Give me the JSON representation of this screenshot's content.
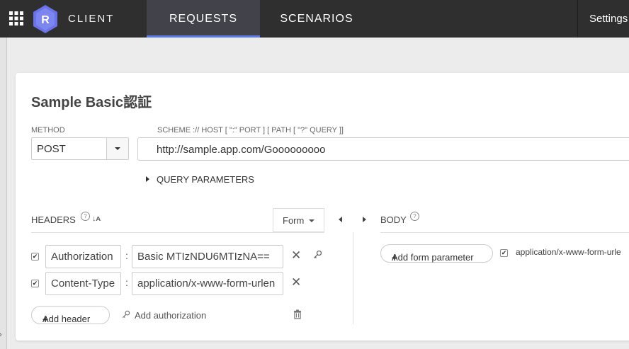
{
  "nav": {
    "logo_letter": "R",
    "brand": "CLIENT",
    "tabs": [
      {
        "label": "REQUESTS",
        "active": true
      },
      {
        "label": "SCENARIOS",
        "active": false
      }
    ],
    "settings": "Settings"
  },
  "request": {
    "title": "Sample Basic認証",
    "method_label": "METHOD",
    "method": "POST",
    "url_label": "SCHEME :// HOST [ \":\" PORT ] [ PATH [ \"?\" QUERY ]]",
    "url": "http://sample.app.com/Gooooooooo",
    "query_params": "QUERY PARAMETERS"
  },
  "headers": {
    "title": "HEADERS",
    "mode": "Form",
    "rows": [
      {
        "name": "Authorization",
        "value": "Basic MTIzNDU6MTIzNA==",
        "enabled": true
      },
      {
        "name": "Content-Type",
        "value": "application/x-www-form-urlen",
        "enabled": true
      }
    ],
    "add_header": "Add header",
    "add_authorization": "Add authorization"
  },
  "body": {
    "title": "BODY",
    "add_form_parameter": "Add form parameter",
    "content_type": "application/x-www-form-urle",
    "content_type_enabled": true
  },
  "colors": {
    "nav_bg": "#2f2f2f",
    "active_tab_bg": "#41424a",
    "accent": "#5b7be9",
    "logo": "#6b73e8"
  }
}
